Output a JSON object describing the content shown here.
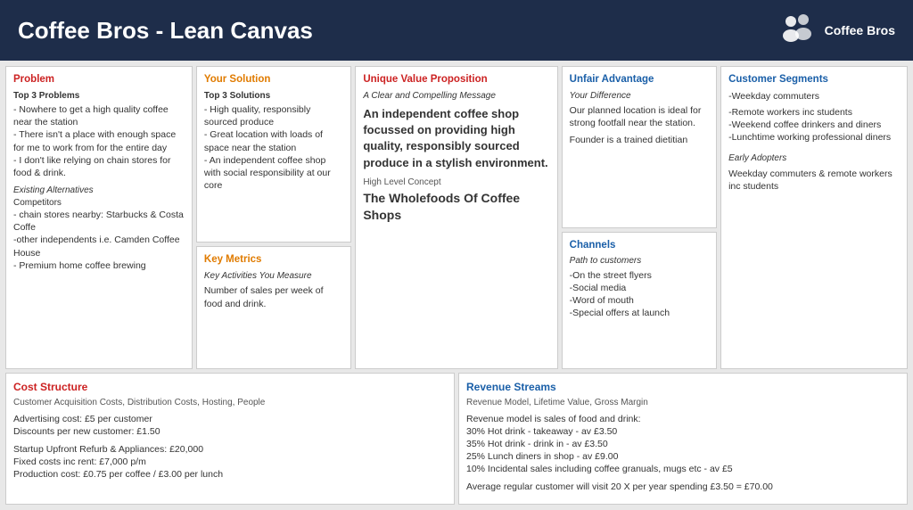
{
  "header": {
    "title": "Coffee Bros - Lean Canvas",
    "logo_text": "Coffee Bros"
  },
  "problem": {
    "section_title": "Problem",
    "subtitle": "Top 3 Problems",
    "items": [
      "- Nowhere to get a high quality coffee near the station",
      "- There isn't a place with enough space for me to work from for the entire day",
      "- I don't like relying on chain stores for food & drink."
    ],
    "existing_label": "Existing Alternatives",
    "competitors_label": "Competitors",
    "competitor_items": [
      "- chain stores nearby: Starbucks & Costa Coffe",
      "-other independents i.e. Camden Coffee House",
      "- Premium home coffee brewing"
    ]
  },
  "solution": {
    "section_title": "Your Solution",
    "subtitle": "Top 3 Solutions",
    "items": [
      "- High quality, responsibly sourced produce",
      "- Great location with loads of space near the station",
      "- An independent coffee shop with social responsibility at our core"
    ],
    "metrics_title": "Key Metrics",
    "metrics_subtitle": "Key Activities You Measure",
    "metrics_body": "Number of sales per week of food and drink."
  },
  "uvp": {
    "section_title": "Unique Value Proposition",
    "subtitle": "A Clear and Compelling Message",
    "big_text": "An independent coffee shop focussed on providing high quality, responsibly sourced produce in a stylish environment.",
    "concept_label": "High Level Concept",
    "concept_value": "The Wholefoods Of Coffee Shops"
  },
  "unfair": {
    "section_title": "Unfair Advantage",
    "subtitle": "Your Difference",
    "body": "Our planned location is ideal for strong footfall near the station.",
    "extra": "Founder is a trained dietitian",
    "channels_title": "Channels",
    "channels_subtitle": "Path to customers",
    "channels_items": [
      "-On the street flyers",
      "-Social media",
      "-Word of mouth",
      "-Special offers at launch"
    ]
  },
  "customer": {
    "section_title": "Customer Segments",
    "items": [
      "-Weekday commuters",
      "-Remote workers inc students",
      "-Weekend coffee drinkers and diners",
      "-Lunchtime working professional diners"
    ],
    "early_adopters_label": "Early Adopters",
    "early_adopters_value": "Weekday commuters & remote workers inc students"
  },
  "cost": {
    "section_title": "Cost Structure",
    "subtitle": "Customer Acquisition Costs, Distribution Costs, Hosting, People",
    "line1": "Advertising cost: £5 per customer",
    "line2": "Discounts per new customer: £1.50",
    "line3": "",
    "line4": "Startup Upfront Refurb & Appliances: £20,000",
    "line5": "Fixed costs inc rent: £7,000 p/m",
    "line6": "Production cost: £0.75 per coffee / £3.00 per lunch"
  },
  "revenue": {
    "section_title": "Revenue Streams",
    "subtitle": "Revenue Model, Lifetime Value, Gross Margin",
    "line1": "Revenue model is sales of food and drink:",
    "line2": "30% Hot drink - takeaway - av £3.50",
    "line3": "35% Hot drink - drink in - av £3.50",
    "line4": "25% Lunch diners in shop - av £9.00",
    "line5": "10% Incidental sales including coffee granuals, mugs etc - av £5",
    "line6": "",
    "line7": "Average regular customer will visit 20 X per year spending £3.50 = £70.00"
  }
}
